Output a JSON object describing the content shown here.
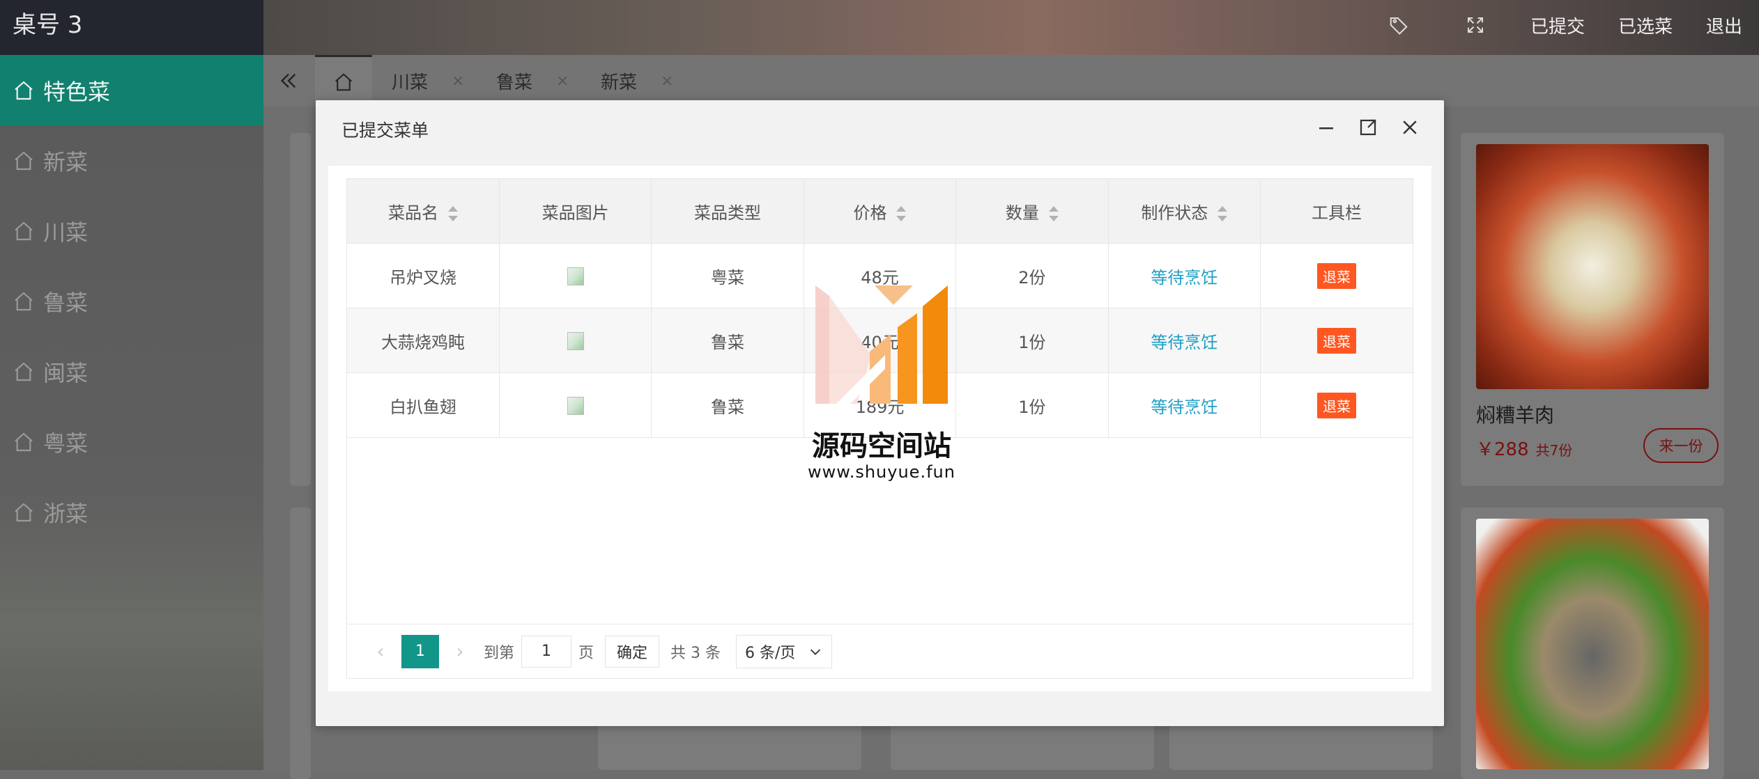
{
  "header": {
    "table_label": "桌号 3",
    "tools": [
      "已提交",
      "已选菜",
      "退出"
    ]
  },
  "sidebar": {
    "items": [
      "特色菜",
      "新菜",
      "川菜",
      "鲁菜",
      "闽菜",
      "粤菜",
      "浙菜"
    ]
  },
  "tabs": {
    "items": [
      {
        "label": "川菜",
        "close": "×"
      },
      {
        "label": "鲁菜",
        "close": "×"
      },
      {
        "label": "新菜",
        "close": "×"
      }
    ]
  },
  "card": {
    "name": "焖糟羊肉",
    "price": "￥288",
    "count": "共7份",
    "add": "来一份"
  },
  "modal": {
    "title": "已提交菜单",
    "columns": [
      "菜品名",
      "菜品图片",
      "菜品类型",
      "价格",
      "数量",
      "制作状态",
      "工具栏"
    ],
    "rows": [
      {
        "name": "吊炉叉烧",
        "type": "粤菜",
        "price": "48元",
        "qty": "2份",
        "status": "等待烹饪",
        "action": "退菜"
      },
      {
        "name": "大蒜烧鸡盹",
        "type": "鲁菜",
        "price": "40元",
        "qty": "1份",
        "status": "等待烹饪",
        "action": "退菜"
      },
      {
        "name": "白扒鱼翅",
        "type": "鲁菜",
        "price": "189元",
        "qty": "1份",
        "status": "等待烹饪",
        "action": "退菜"
      }
    ],
    "pager": {
      "current": "1",
      "goto_label": "到第",
      "goto_value": "1",
      "page_label": "页",
      "ok": "确定",
      "total": "共 3 条",
      "per_page": "6 条/页"
    }
  },
  "watermark": {
    "cn": "源码空间站",
    "url": "www.shuyue.fun"
  },
  "colors": {
    "accent": "#12806f",
    "status": "#1e9fc4",
    "danger": "#ff5722"
  }
}
